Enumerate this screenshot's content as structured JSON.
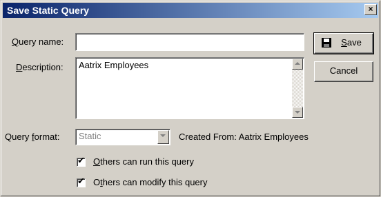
{
  "window": {
    "title": "Save Static Query",
    "close_glyph": "×"
  },
  "form": {
    "query_name": {
      "label_mnemonic": "Q",
      "label_rest": "uery name:",
      "value": ""
    },
    "description": {
      "label_mnemonic": "D",
      "label_rest": "escription:",
      "value": "Aatrix Employees"
    },
    "query_format": {
      "label_before": "Query ",
      "label_mnemonic": "f",
      "label_after": "ormat:",
      "selected": "Static"
    },
    "created_from": "Created From: Aatrix Employees",
    "others_can_run": {
      "label_mnemonic": "O",
      "label_rest": "thers can run this query",
      "checked": true
    },
    "others_can_modify": {
      "label_before": "O",
      "label_mnemonic": "t",
      "label_rest": "hers can modify this query",
      "checked": true
    }
  },
  "buttons": {
    "save_mnemonic": "S",
    "save_rest": "ave",
    "cancel": "Cancel"
  },
  "icons": {
    "save": "floppy-disk-icon",
    "close": "close-icon",
    "scroll_up": "arrow-up-icon",
    "scroll_down": "arrow-down-icon",
    "dropdown": "chevron-down-icon",
    "checkmark": "checkmark-icon"
  },
  "colors": {
    "title_gradient_start": "#0a246a",
    "title_gradient_end": "#a6caf0",
    "dialog_face": "#d4d0c8"
  }
}
